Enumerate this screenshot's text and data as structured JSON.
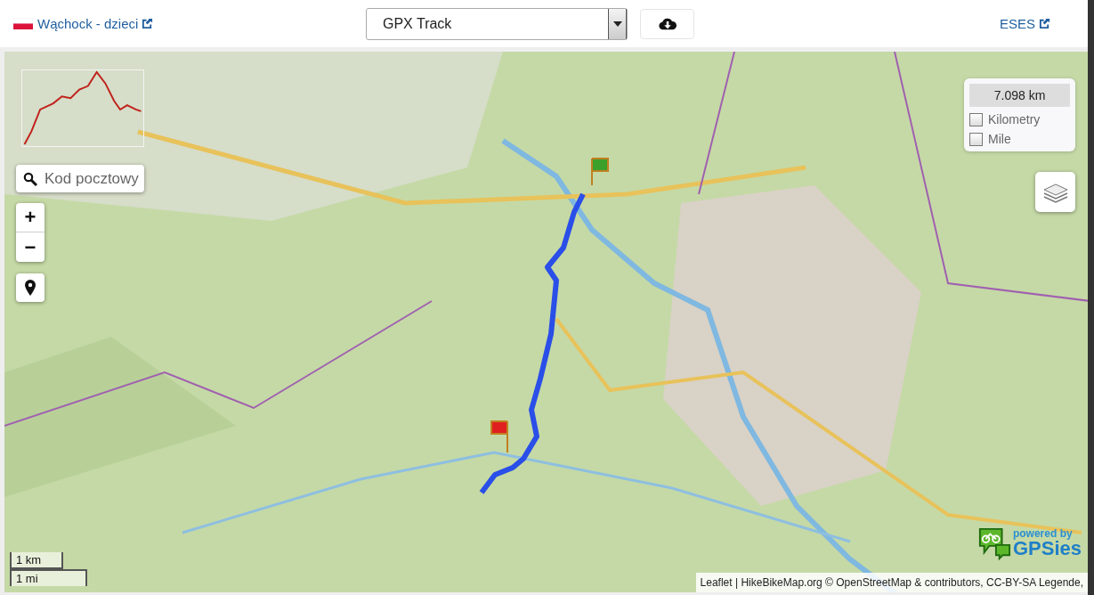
{
  "header": {
    "title_link": "Wąchock - dzieci",
    "track_select": {
      "value": "GPX Track"
    },
    "right_link": "ESES"
  },
  "map": {
    "kind": "picture",
    "search": {
      "placeholder": "Kod pocztowy"
    },
    "zoom": [
      "+",
      "−"
    ],
    "distance": {
      "value": "7.098 km",
      "units": [
        {
          "label": "Kilometry",
          "checked": false
        },
        {
          "label": "Mile",
          "checked": false
        }
      ]
    },
    "scale": [
      "1 km",
      "1 mi"
    ],
    "logo": {
      "tagline": "powered by",
      "name": "GPSies"
    },
    "attribution": "Leaflet | HikeBikeMap.org © OpenStreetMap & contributors, CC-BY-SA Legende,"
  }
}
